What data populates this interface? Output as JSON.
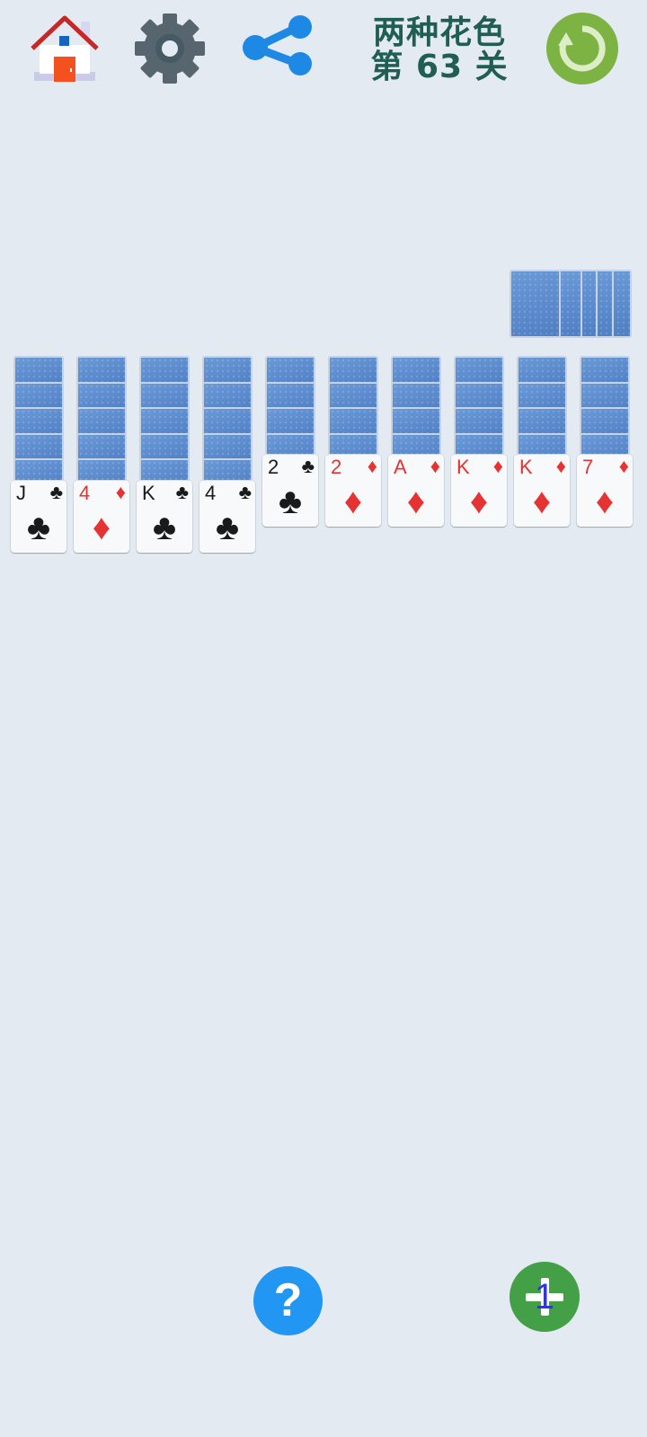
{
  "header": {
    "title_line1": "两种花色",
    "title_line2": "第 63 关"
  },
  "tableau": [
    {
      "hidden": 5,
      "card": {
        "rank": "J",
        "suit": "♣",
        "color": "black"
      }
    },
    {
      "hidden": 5,
      "card": {
        "rank": "4",
        "suit": "♦",
        "color": "red"
      }
    },
    {
      "hidden": 5,
      "card": {
        "rank": "K",
        "suit": "♣",
        "color": "black"
      }
    },
    {
      "hidden": 5,
      "card": {
        "rank": "4",
        "suit": "♣",
        "color": "black"
      }
    },
    {
      "hidden": 4,
      "card": {
        "rank": "2",
        "suit": "♣",
        "color": "black"
      }
    },
    {
      "hidden": 4,
      "card": {
        "rank": "2",
        "suit": "♦",
        "color": "red"
      }
    },
    {
      "hidden": 4,
      "card": {
        "rank": "A",
        "suit": "♦",
        "color": "red"
      }
    },
    {
      "hidden": 4,
      "card": {
        "rank": "K",
        "suit": "♦",
        "color": "red"
      }
    },
    {
      "hidden": 4,
      "card": {
        "rank": "K",
        "suit": "♦",
        "color": "red"
      }
    },
    {
      "hidden": 4,
      "card": {
        "rank": "7",
        "suit": "♦",
        "color": "red"
      }
    }
  ],
  "stock": {
    "piles": 5
  },
  "buttons": {
    "help_label": "?",
    "deal_count": "1"
  },
  "colors": {
    "background": "#e3eaf2",
    "title": "#1f5e50",
    "help": "#2196f3",
    "deal": "#43a047",
    "restart": "#7cb342",
    "red_suit": "#e53232"
  }
}
